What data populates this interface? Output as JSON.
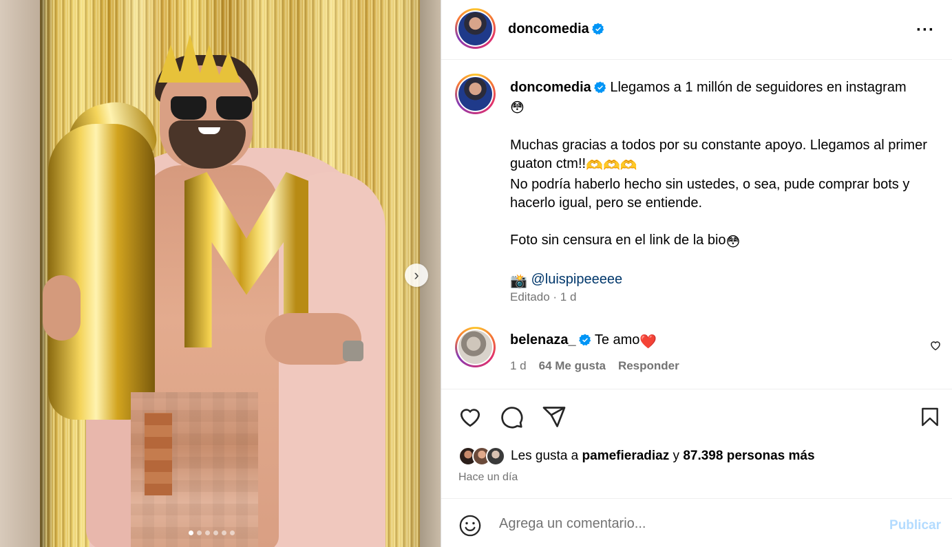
{
  "post": {
    "username": "doncomedia",
    "caption_line1": "Llegamos a 1 millón de seguidores en instagram",
    "caption_p2_a": "Muchas gracias a todos por su constante apoyo. Llegamos al primer guaton ctm!!",
    "caption_p2_b": "No podría haberlo hecho sin ustedes, o sea, pude comprar bots y hacerlo igual, pero se entiende.",
    "caption_p3": "Foto sin censura en el link de la bio",
    "credit_mention": "@luispipeeeee",
    "edited_meta": "Editado · 1 d"
  },
  "carousel": {
    "total_slides": 6,
    "active_slide": 1
  },
  "comment": {
    "username": "belenaza_",
    "text": "Te amo",
    "time": "1 d",
    "likes": "64 Me gusta",
    "reply_label": "Responder"
  },
  "likes": {
    "prefix": "Les gusta a",
    "liker": "pamefieradiaz",
    "joiner": "y",
    "others": "87.398 personas más",
    "time_ago": "Hace un día"
  },
  "add_comment": {
    "placeholder": "Agrega un comentario...",
    "publish_label": "Publicar"
  },
  "colors": {
    "verified": "#0095f6",
    "mention": "#00376b",
    "secondary_text": "#737373",
    "publish_disabled": "#b3dbff"
  },
  "icons": [
    "more-icon",
    "next-arrow-icon",
    "verified-icon",
    "heart-icon",
    "comment-icon",
    "share-icon",
    "bookmark-icon",
    "emoji-smiley-icon"
  ]
}
